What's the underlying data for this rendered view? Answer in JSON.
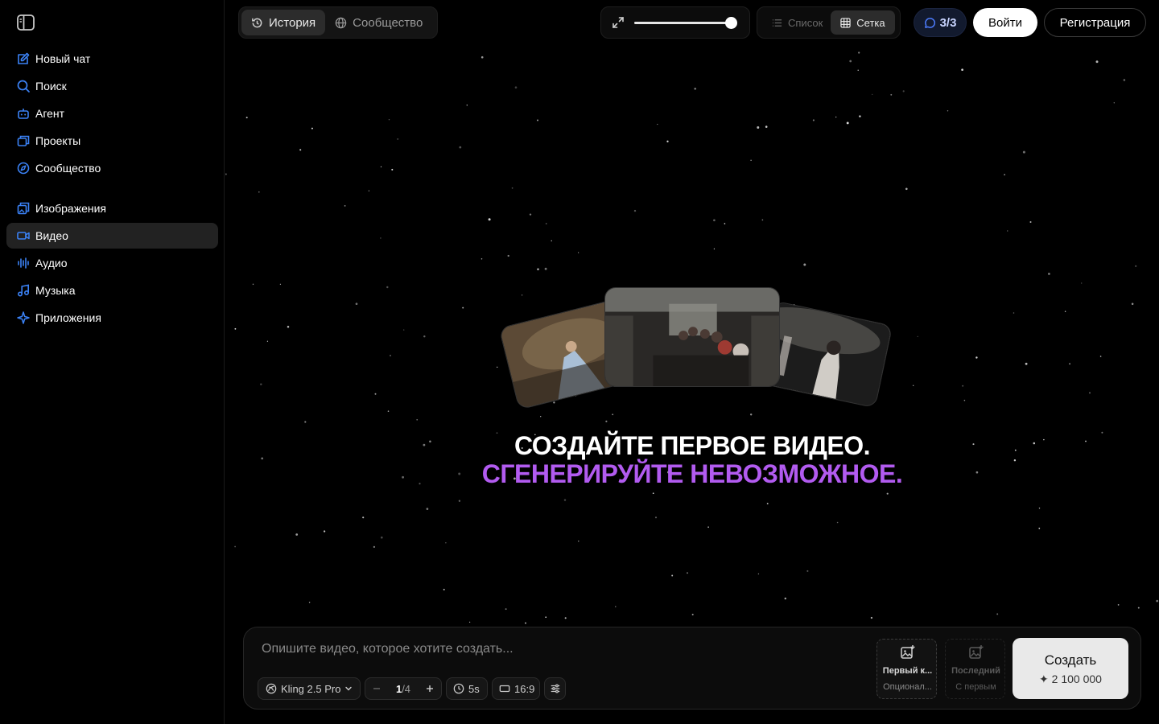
{
  "sidebar": {
    "items": [
      {
        "label": "Новый чат",
        "icon": "edit-icon"
      },
      {
        "label": "Поиск",
        "icon": "search-icon"
      },
      {
        "label": "Агент",
        "icon": "robot-icon"
      },
      {
        "label": "Проекты",
        "icon": "folders-icon"
      },
      {
        "label": "Сообщество",
        "icon": "compass-icon"
      },
      {
        "label": "Изображения",
        "icon": "images-icon"
      },
      {
        "label": "Видео",
        "icon": "video-icon",
        "active": true
      },
      {
        "label": "Аудио",
        "icon": "audio-wave-icon"
      },
      {
        "label": "Музыка",
        "icon": "music-note-icon"
      },
      {
        "label": "Приложения",
        "icon": "sparkle-icon"
      }
    ]
  },
  "topbar": {
    "tabs": [
      {
        "label": "История",
        "icon": "history-icon",
        "active": true
      },
      {
        "label": "Сообщество",
        "icon": "globe-icon",
        "active": false
      }
    ],
    "zoom_level": 1.0,
    "views": [
      {
        "label": "Список",
        "icon": "list-icon",
        "active": false
      },
      {
        "label": "Сетка",
        "icon": "grid-icon",
        "active": true
      }
    ],
    "counter": "3/3",
    "login_label": "Войти",
    "register_label": "Регистрация"
  },
  "hero": {
    "title": "СОЗДАЙТЕ ПЕРВОЕ ВИДЕО.",
    "subtitle": "СГЕНЕРИРУЙТЕ НЕВОЗМОЖНОЕ."
  },
  "composer": {
    "placeholder": "Опишите видео, которое хотите создать...",
    "model": "Kling 2.5 Pro",
    "count_current": "1",
    "count_total": "/4",
    "duration": "5s",
    "aspect_ratio": "16:9",
    "first_frame": {
      "title": "Первый к...",
      "subtitle": "Опционал..."
    },
    "last_frame": {
      "title": "Последний",
      "subtitle": "С первым"
    },
    "create_label": "Создать",
    "create_cost": "✦ 2 100 000"
  },
  "colors": {
    "accent_purple": "#b25bf0",
    "icon_blue": "#3b82f6",
    "background": "#000000"
  }
}
